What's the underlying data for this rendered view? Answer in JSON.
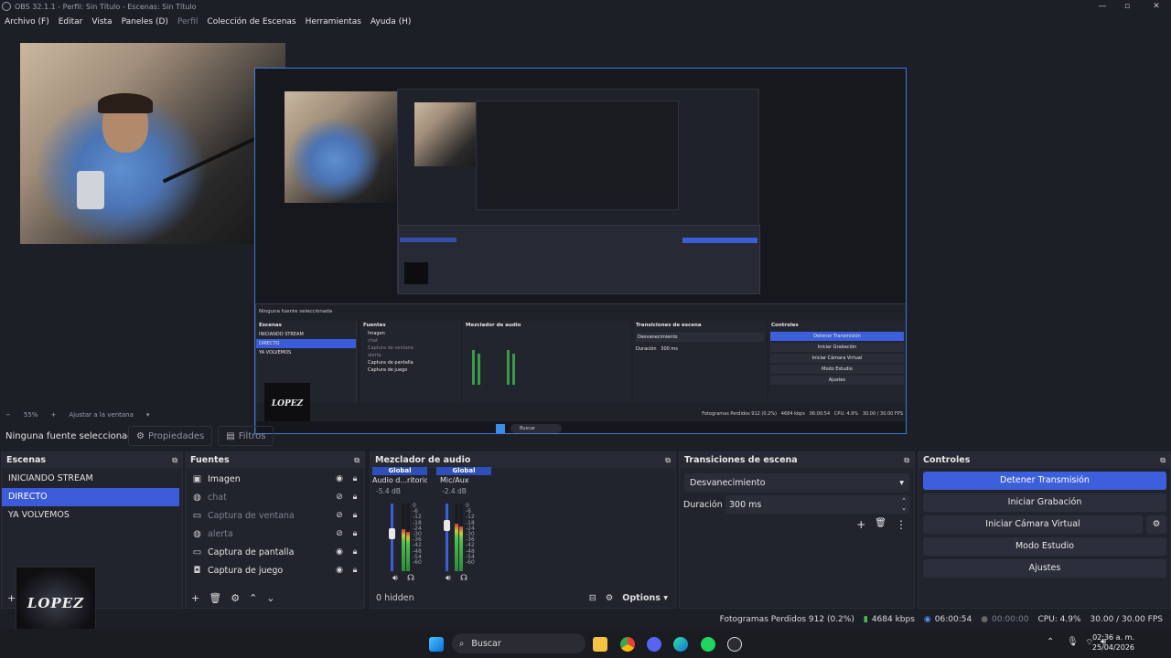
{
  "window": {
    "title": "OBS 32.1.1 - Perfil: Sin Título - Escenas: Sin Título"
  },
  "menu": [
    {
      "label": "Archivo (F)",
      "enabled": true
    },
    {
      "label": "Editar",
      "enabled": true
    },
    {
      "label": "Vista",
      "enabled": true
    },
    {
      "label": "Paneles (D)",
      "enabled": true
    },
    {
      "label": "Perfil",
      "enabled": false
    },
    {
      "label": "Colección de Escenas",
      "enabled": true
    },
    {
      "label": "Herramientas",
      "enabled": true
    },
    {
      "label": "Ayuda (H)",
      "enabled": true
    }
  ],
  "zoom": {
    "level": "55%",
    "fit_label": "Ajustar a la ventana"
  },
  "source_toolbar": {
    "no_source": "Ninguna fuente seleccionada",
    "properties": "Propiedades",
    "filters": "Filtros"
  },
  "scenes": {
    "title": "Escenas",
    "items": [
      "INICIANDO STREAM",
      "DIRECTO",
      "YA VOLVEMOS"
    ],
    "selected_index": 1
  },
  "sources": {
    "title": "Fuentes",
    "items": [
      {
        "label": "Imagen",
        "icon": "image-icon",
        "visible": true,
        "locked": true
      },
      {
        "label": "chat",
        "icon": "browser-icon",
        "visible": false,
        "locked": true
      },
      {
        "label": "Captura de ventana",
        "icon": "window-capture-icon",
        "visible": false,
        "locked": true
      },
      {
        "label": "alerta",
        "icon": "browser-icon",
        "visible": false,
        "locked": true
      },
      {
        "label": "Captura de pantalla",
        "icon": "monitor-icon",
        "visible": true,
        "locked": true
      },
      {
        "label": "Captura de juego",
        "icon": "gamepad-icon",
        "visible": true,
        "locked": true
      }
    ]
  },
  "mixer": {
    "title": "Mezclador de audio",
    "channels": [
      {
        "tag": "Global",
        "name": "Audio d...ritorio",
        "db": "-5.4 dB",
        "level": 0.62,
        "fader": 0.55
      },
      {
        "tag": "Global",
        "name": "Mic/Aux",
        "db": "-2.4 dB",
        "level": 0.7,
        "fader": 0.68
      }
    ],
    "scale": [
      "0",
      "-6",
      "-12",
      "-18",
      "-24",
      "-30",
      "-36",
      "-42",
      "-48",
      "-54",
      "-60"
    ],
    "hidden_label": "0 hidden",
    "options_label": "Options"
  },
  "transitions": {
    "title": "Transiciones de escena",
    "selected": "Desvanecimiento",
    "duration_label": "Duración",
    "duration_value": "300 ms"
  },
  "controls": {
    "title": "Controles",
    "buttons": [
      "Detener Transmisión",
      "Iniciar Grabación",
      "Iniciar Cámara Virtual",
      "Modo Estudio",
      "Ajustes"
    ]
  },
  "status": {
    "dropped": "Fotogramas Perdidos 912 (0.2%)",
    "bitrate": "4684 kbps",
    "stream_time": "06:00:54",
    "rec_time": "00:00:00",
    "cpu": "CPU: 4.9%",
    "fps": "30.00 / 30.00 FPS"
  },
  "taskbar": {
    "search": "Buscar",
    "time": "02:36 a. m.",
    "date": "25/04/2026"
  },
  "overlay": {
    "logo_text": "LOPEZ"
  },
  "colors": {
    "accent": "#3c5fdc",
    "selection": "#3b5bd9",
    "bg": "#1d1f27",
    "dock": "#22242d"
  }
}
